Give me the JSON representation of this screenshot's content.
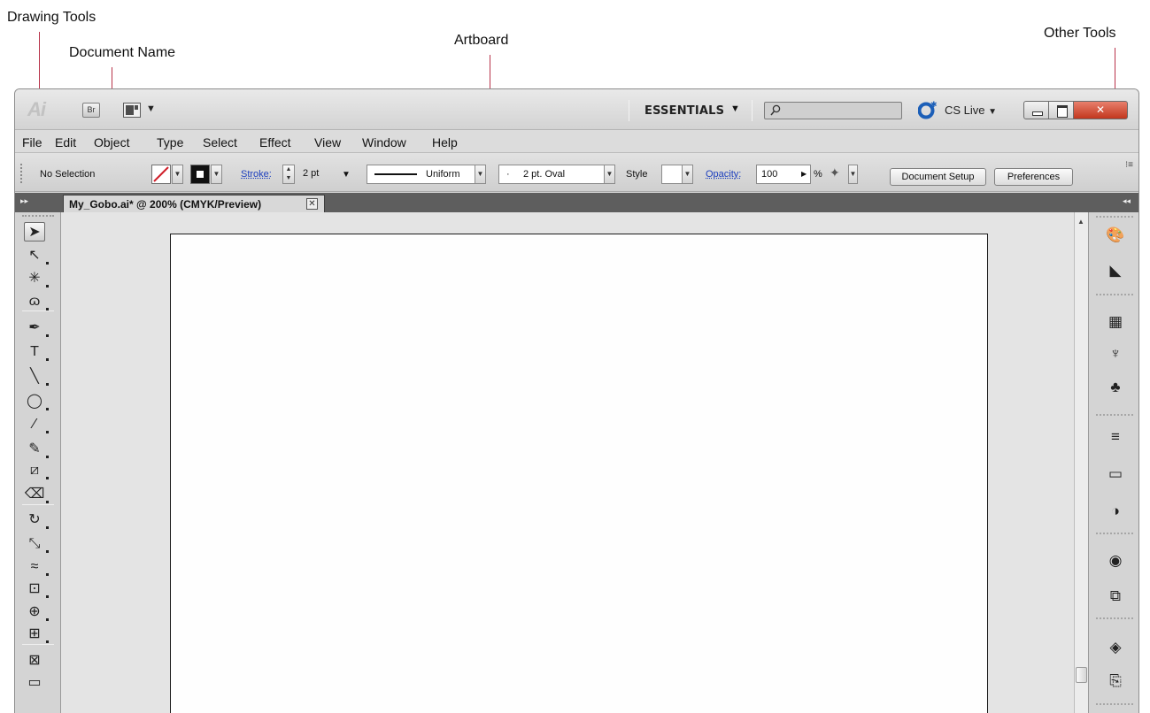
{
  "callouts": {
    "drawing_tools": "Drawing Tools",
    "document_name": "Document Name",
    "artboard": "Artboard",
    "other_tools": "Other Tools"
  },
  "app": {
    "logo": "Ai",
    "bridge_button": "Br",
    "workspace": "ESSENTIALS",
    "cs_live": "CS Live",
    "search_value": ""
  },
  "menu": {
    "items": [
      "File",
      "Edit",
      "Object",
      "Type",
      "Select",
      "Effect",
      "View",
      "Window",
      "Help"
    ]
  },
  "control_bar": {
    "selection_status": "No Selection",
    "stroke_label": "Stroke:",
    "stroke_weight": "2 pt",
    "stroke_profile": "Uniform",
    "brush": "2 pt. Oval",
    "style_label": "Style",
    "opacity_label": "Opacity:",
    "opacity_value": "100",
    "opacity_unit": "%",
    "document_setup_button": "Document Setup",
    "preferences_button": "Preferences"
  },
  "document": {
    "tab_title": "My_Gobo.ai* @ 200% (CMYK/Preview)"
  },
  "colors": {
    "accent_leader": "#b8334a",
    "close_button": "#c2361e",
    "link_blue": "#1d3fbe",
    "tabstrip": "#5e5e5e"
  },
  "tools_panel": {
    "tools": [
      {
        "name": "selection-tool-icon",
        "glyph": "➤",
        "active": true
      },
      {
        "name": "direct-selection-tool-icon",
        "glyph": "↖"
      },
      {
        "name": "magic-wand-tool-icon",
        "glyph": "✳"
      },
      {
        "name": "lasso-tool-icon",
        "glyph": "ɷ"
      },
      {
        "name": "pen-tool-icon",
        "glyph": "✒"
      },
      {
        "name": "type-tool-icon",
        "glyph": "T"
      },
      {
        "name": "line-segment-tool-icon",
        "glyph": "╲"
      },
      {
        "name": "ellipse-tool-icon",
        "glyph": "◯"
      },
      {
        "name": "paintbrush-tool-icon",
        "glyph": "⁄"
      },
      {
        "name": "pencil-tool-icon",
        "glyph": "✎"
      },
      {
        "name": "blob-brush-tool-icon",
        "glyph": "⧄"
      },
      {
        "name": "eraser-tool-icon",
        "glyph": "⌫"
      },
      {
        "name": "rotate-tool-icon",
        "glyph": "↻"
      },
      {
        "name": "scale-tool-icon",
        "glyph": "⤡"
      },
      {
        "name": "warp-tool-icon",
        "glyph": "≈"
      },
      {
        "name": "free-transform-tool-icon",
        "glyph": "⊡"
      },
      {
        "name": "shape-builder-tool-icon",
        "glyph": "⊕"
      },
      {
        "name": "perspective-grid-tool-icon",
        "glyph": "⊞"
      },
      {
        "name": "mesh-tool-icon",
        "glyph": "⊠"
      },
      {
        "name": "gradient-tool-icon",
        "glyph": "▭"
      }
    ]
  },
  "other_panel": {
    "icons": [
      {
        "name": "color-panel-icon",
        "glyph": "🎨"
      },
      {
        "name": "color-guide-panel-icon",
        "glyph": "◣"
      },
      {
        "name": "swatches-panel-icon",
        "glyph": "▦"
      },
      {
        "name": "brushes-panel-icon",
        "glyph": "♆"
      },
      {
        "name": "symbols-panel-icon",
        "glyph": "♣"
      },
      {
        "name": "stroke-panel-icon",
        "glyph": "≡"
      },
      {
        "name": "gradient-panel-icon",
        "glyph": "▭"
      },
      {
        "name": "transparency-panel-icon",
        "glyph": "◑"
      },
      {
        "name": "appearance-panel-icon",
        "glyph": "◉"
      },
      {
        "name": "graphic-styles-panel-icon",
        "glyph": "⧉"
      },
      {
        "name": "layers-panel-icon",
        "glyph": "◈"
      },
      {
        "name": "artboards-panel-icon",
        "glyph": "⎘"
      }
    ]
  }
}
